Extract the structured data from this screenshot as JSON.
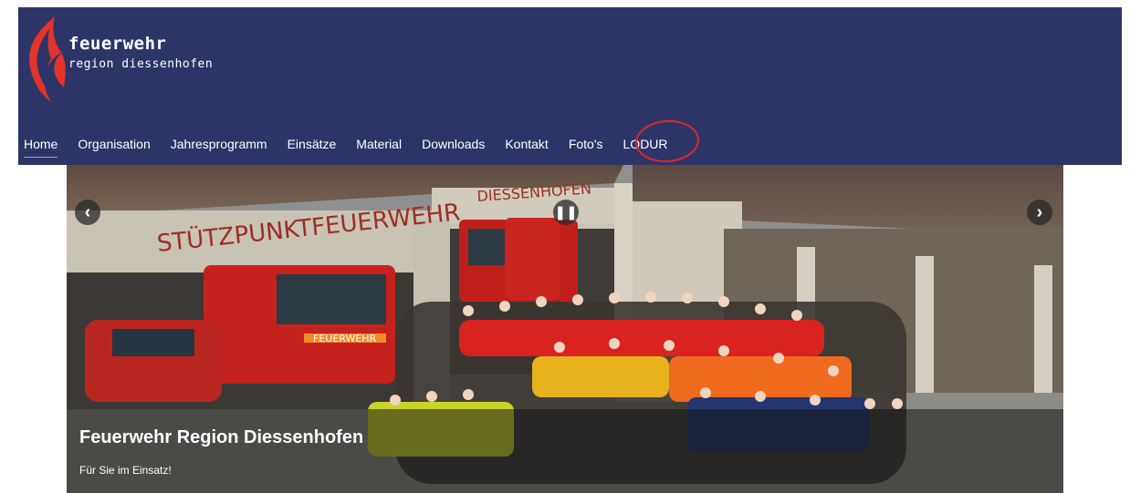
{
  "logo": {
    "title": "feuerwehr",
    "subtitle": "region diessenhofen",
    "icon": "flame-icon"
  },
  "nav": {
    "items": [
      {
        "label": "Home",
        "active": true
      },
      {
        "label": "Organisation"
      },
      {
        "label": "Jahresprogramm"
      },
      {
        "label": "Einsätze"
      },
      {
        "label": "Material"
      },
      {
        "label": "Downloads"
      },
      {
        "label": "Kontakt"
      },
      {
        "label": "Foto's"
      },
      {
        "label": "LODUR"
      }
    ]
  },
  "slider": {
    "prev_icon": "chevron-left-icon",
    "next_icon": "chevron-right-icon",
    "pause_icon": "pause-icon",
    "caption_title": "Feuerwehr Region Diessenhofen",
    "caption_subtitle": "Für Sie im Einsatz!",
    "sign_left": "STÜTZPUNKTFEUERWEHR",
    "sign_right": "DIESSENHOFEN",
    "truck_label": "FEUERWEHR"
  },
  "colors": {
    "header_bg": "#2d3568",
    "annotation_red": "#e0262b",
    "flame_red": "#e2342a"
  }
}
